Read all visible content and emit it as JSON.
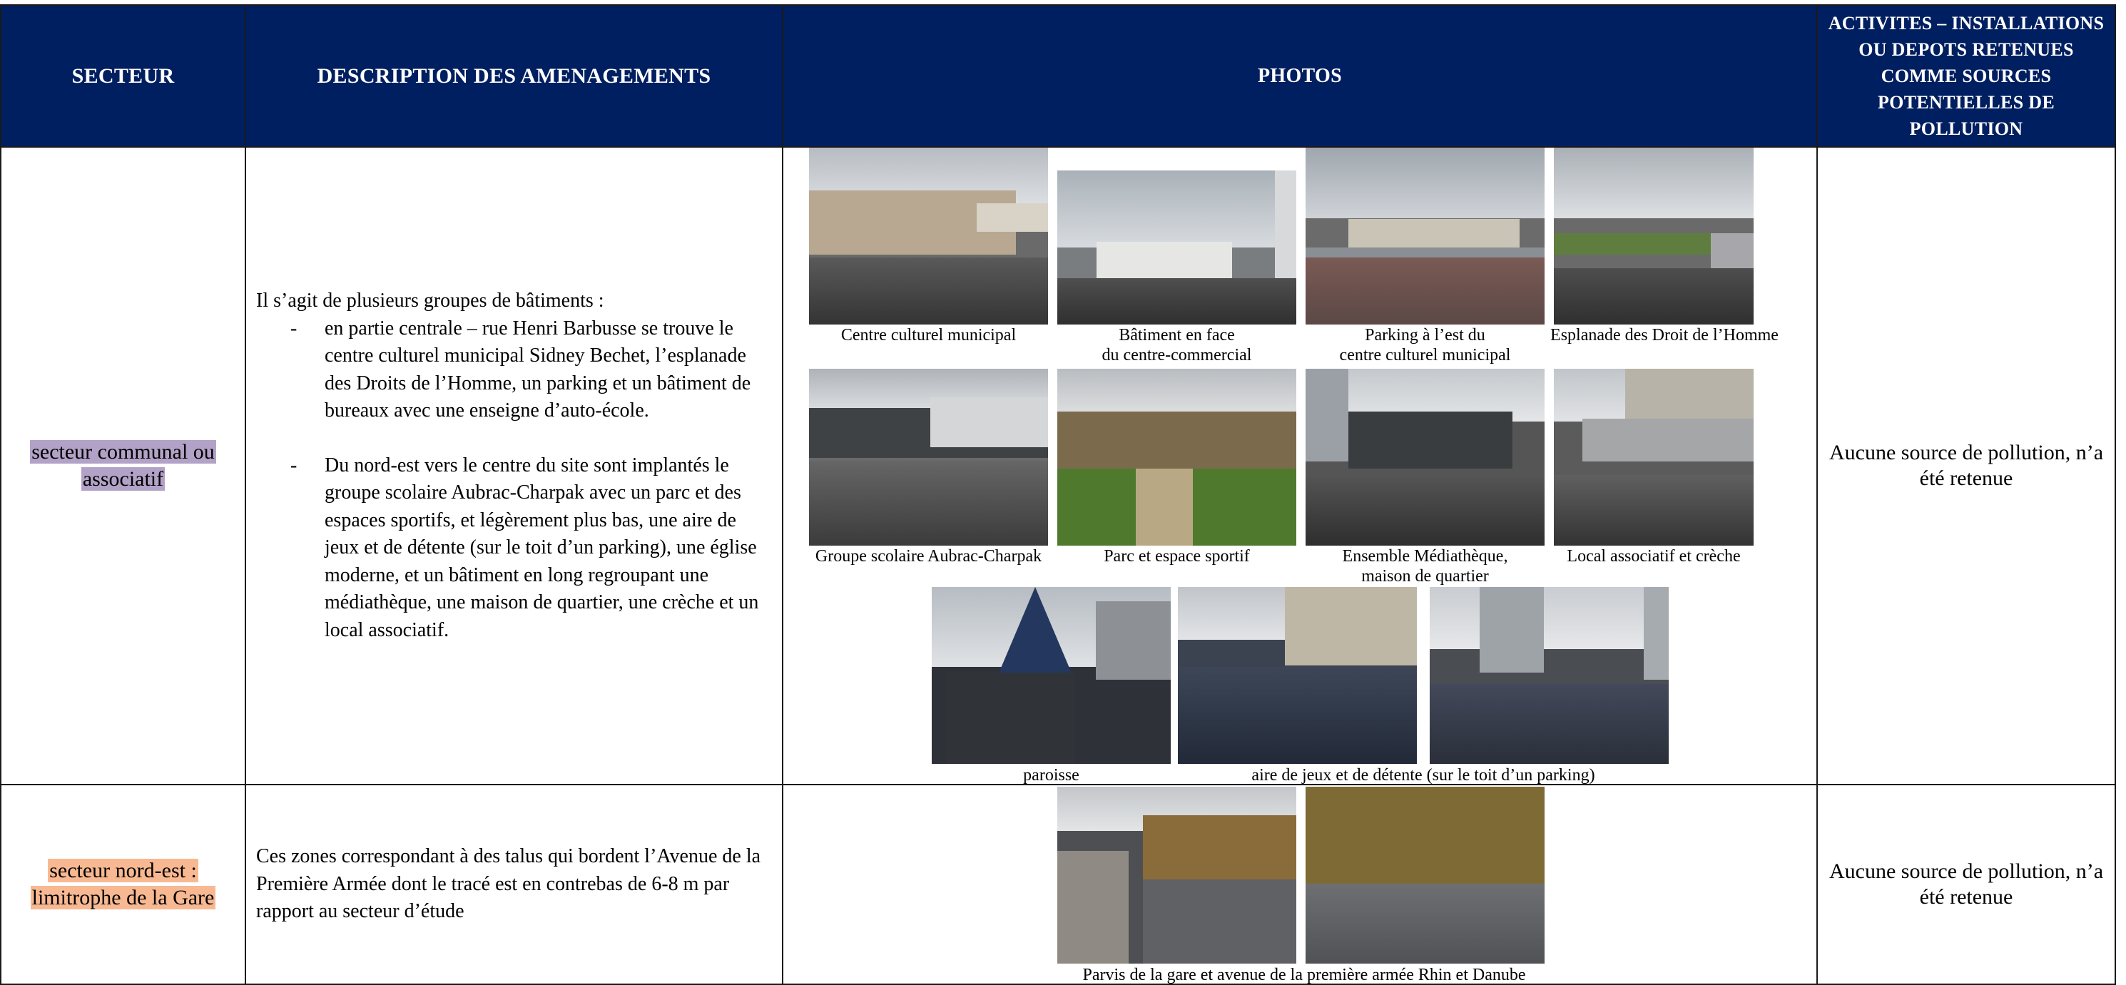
{
  "header": {
    "secteur": "Secteur",
    "description": "Description des amenagements",
    "photos": "photos",
    "activites": "Activites – installations ou depots retenues comme sources potentielles de pollution"
  },
  "rows": [
    {
      "sector": {
        "text": "secteur communal ou associatif",
        "highlight": "#b3a2c7"
      },
      "description": {
        "intro": "Il s’agit de plusieurs groupes de bâtiments :",
        "items": [
          "en partie centrale – rue Henri Barbusse se trouve le centre culturel municipal Sidney Bechet, l’esplanade des Droits de l’Homme, un parking et un bâtiment de bureaux avec une enseigne d’auto-école.",
          "Du nord-est vers le centre du site sont implantés le groupe scolaire Aubrac-Charpak avec un parc et des espaces sportifs, et légèrement plus bas, une aire de jeux et de détente (sur le toit d’un parking), une église moderne, et un bâtiment en long regroupant une médiathèque, une maison de quartier, une crèche et un local associatif."
        ]
      },
      "photos": {
        "captions": [
          "Centre culturel municipal",
          "Bâtiment en face",
          "du centre-commercial",
          "Parking à l’est du",
          "centre culturel municipal",
          "Esplanade des Droit de l’Homme",
          "Groupe scolaire Aubrac-Charpak",
          "Parc et espace sportif",
          "Ensemble Médiathèque,",
          "maison de quartier",
          "Local associatif et crèche",
          "paroisse",
          "aire de jeux et de détente (sur le toit d’un parking)"
        ]
      },
      "result": "Aucune source de pollution, n’a été retenue"
    },
    {
      "sector": {
        "text": "secteur nord-est : limitrophe de la Gare",
        "highlight": "#f8b992"
      },
      "description": {
        "text": "Ces zones correspondant à des talus qui bordent l’Avenue de la Première Armée dont le tracé est en contrebas de 6-8 m par rapport au secteur d’étude"
      },
      "photos": {
        "captions": [
          "Parvis de la gare et avenue de la première armée Rhin et Danube"
        ]
      },
      "result": "Aucune source de pollution, n’a été retenue"
    }
  ],
  "colors": {
    "header_bg": "#001f60",
    "header_text": "#ffffff",
    "highlight_purple": "#b3a2c7",
    "highlight_orange": "#f8b992"
  }
}
